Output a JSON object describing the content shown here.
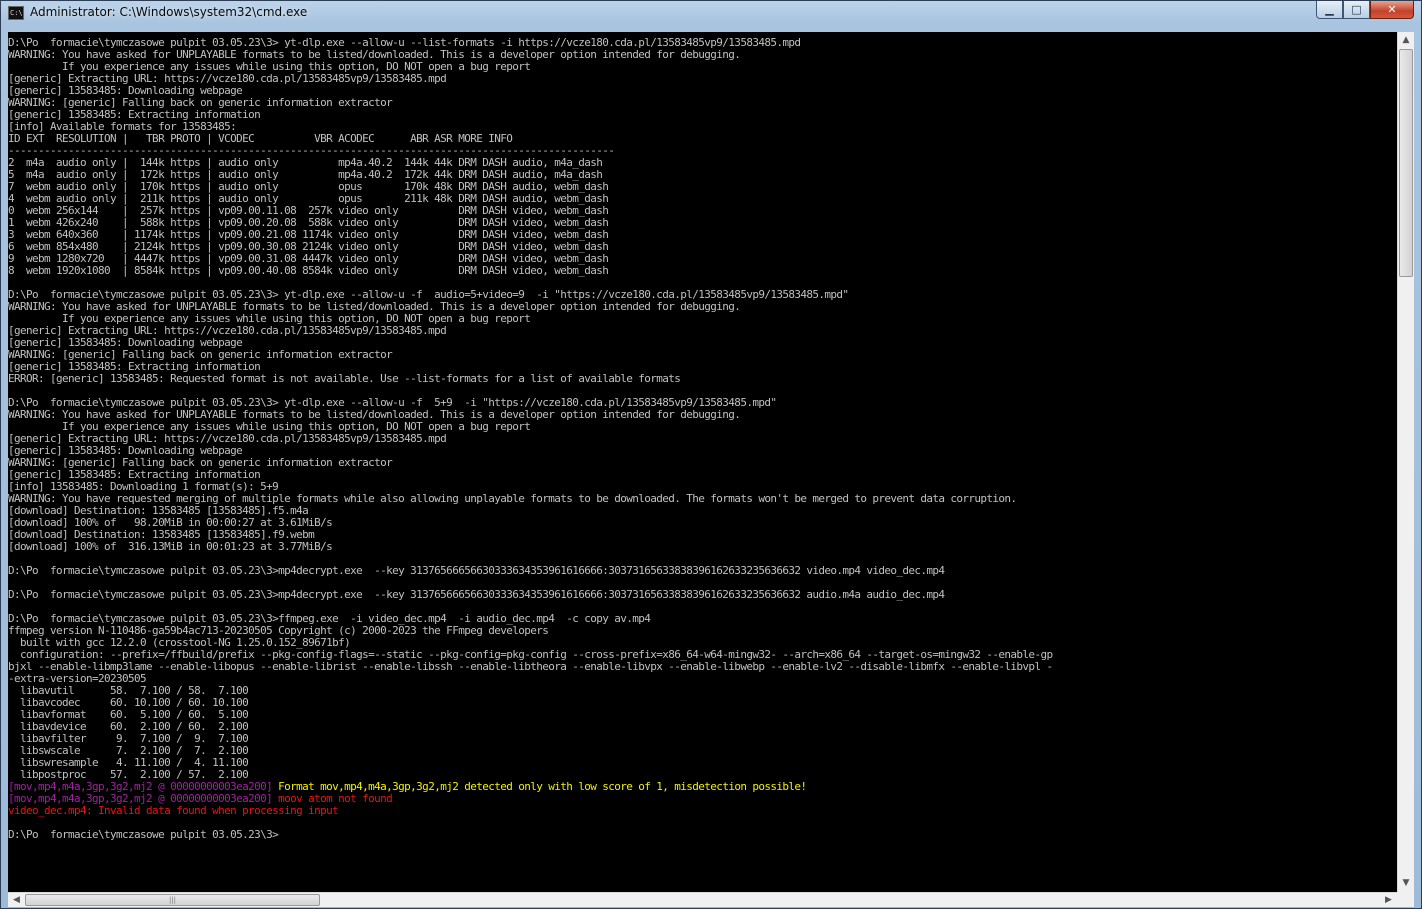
{
  "window": {
    "title": "Administrator: C:\\Windows\\system32\\cmd.exe",
    "icon": "cmd-icon",
    "icon_text": "C:\\",
    "min_glyph": "▁",
    "max_glyph": "□",
    "close_glyph": "✕"
  },
  "console": {
    "colors": {
      "background": "#000000",
      "text": "#c0c0c0",
      "purple": "#a020a0",
      "yellow": "#f0f000",
      "red": "#ee1111"
    },
    "lines": [
      [
        {
          "t": "D:\\Po  formacie\\tymczasowe pulpit 03.05.23\\3> yt-dlp.exe --allow-u --list-formats -i https://vcze180.cda.pl/13583485vp9/13583485.mpd",
          "c": "default"
        }
      ],
      [
        {
          "t": "WARNING: You have asked for UNPLAYABLE formats to be listed/downloaded. This is a developer option intended for debugging.",
          "c": "default"
        }
      ],
      [
        {
          "t": "         If you experience any issues while using this option, DO NOT open a bug report",
          "c": "default"
        }
      ],
      [
        {
          "t": "[generic] Extracting URL: https://vcze180.cda.pl/13583485vp9/13583485.mpd",
          "c": "default"
        }
      ],
      [
        {
          "t": "[generic] 13583485: Downloading webpage",
          "c": "default"
        }
      ],
      [
        {
          "t": "WARNING: [generic] Falling back on generic information extractor",
          "c": "default"
        }
      ],
      [
        {
          "t": "[generic] 13583485: Extracting information",
          "c": "default"
        }
      ],
      [
        {
          "t": "[info] Available formats for 13583485:",
          "c": "default"
        }
      ],
      [
        {
          "t": "ID EXT  RESOLUTION |   TBR PROTO | VCODEC          VBR ACODEC      ABR ASR MORE INFO",
          "c": "default"
        }
      ],
      [
        {
          "t": "-----------------------------------------------------------------------------------------------------",
          "c": "default"
        }
      ],
      [
        {
          "t": "2  m4a  audio only |  144k https | audio only          mp4a.40.2  144k 44k DRM DASH audio, m4a_dash",
          "c": "default"
        }
      ],
      [
        {
          "t": "5  m4a  audio only |  172k https | audio only          mp4a.40.2  172k 44k DRM DASH audio, m4a_dash",
          "c": "default"
        }
      ],
      [
        {
          "t": "7  webm audio only |  170k https | audio only          opus       170k 48k DRM DASH audio, webm_dash",
          "c": "default"
        }
      ],
      [
        {
          "t": "4  webm audio only |  211k https | audio only          opus       211k 48k DRM DASH audio, webm_dash",
          "c": "default"
        }
      ],
      [
        {
          "t": "0  webm 256x144    |  257k https | vp09.00.11.08  257k video only          DRM DASH video, webm_dash",
          "c": "default"
        }
      ],
      [
        {
          "t": "1  webm 426x240    |  588k https | vp09.00.20.08  588k video only          DRM DASH video, webm_dash",
          "c": "default"
        }
      ],
      [
        {
          "t": "3  webm 640x360    | 1174k https | vp09.00.21.08 1174k video only          DRM DASH video, webm_dash",
          "c": "default"
        }
      ],
      [
        {
          "t": "6  webm 854x480    | 2124k https | vp09.00.30.08 2124k video only          DRM DASH video, webm_dash",
          "c": "default"
        }
      ],
      [
        {
          "t": "9  webm 1280x720   | 4447k https | vp09.00.31.08 4447k video only          DRM DASH video, webm_dash",
          "c": "default"
        }
      ],
      [
        {
          "t": "8  webm 1920x1080  | 8584k https | vp09.00.40.08 8584k video only          DRM DASH video, webm_dash",
          "c": "default"
        }
      ],
      [
        {
          "t": "",
          "c": "default"
        }
      ],
      [
        {
          "t": "D:\\Po  formacie\\tymczasowe pulpit 03.05.23\\3> yt-dlp.exe --allow-u -f  audio=5+video=9  -i \"https://vcze180.cda.pl/13583485vp9/13583485.mpd\"",
          "c": "default"
        }
      ],
      [
        {
          "t": "WARNING: You have asked for UNPLAYABLE formats to be listed/downloaded. This is a developer option intended for debugging.",
          "c": "default"
        }
      ],
      [
        {
          "t": "         If you experience any issues while using this option, DO NOT open a bug report",
          "c": "default"
        }
      ],
      [
        {
          "t": "[generic] Extracting URL: https://vcze180.cda.pl/13583485vp9/13583485.mpd",
          "c": "default"
        }
      ],
      [
        {
          "t": "[generic] 13583485: Downloading webpage",
          "c": "default"
        }
      ],
      [
        {
          "t": "WARNING: [generic] Falling back on generic information extractor",
          "c": "default"
        }
      ],
      [
        {
          "t": "[generic] 13583485: Extracting information",
          "c": "default"
        }
      ],
      [
        {
          "t": "ERROR: [generic] 13583485: Requested format is not available. Use --list-formats for a list of available formats",
          "c": "default"
        }
      ],
      [
        {
          "t": "",
          "c": "default"
        }
      ],
      [
        {
          "t": "D:\\Po  formacie\\tymczasowe pulpit 03.05.23\\3> yt-dlp.exe --allow-u -f  5+9  -i \"https://vcze180.cda.pl/13583485vp9/13583485.mpd\"",
          "c": "default"
        }
      ],
      [
        {
          "t": "WARNING: You have asked for UNPLAYABLE formats to be listed/downloaded. This is a developer option intended for debugging.",
          "c": "default"
        }
      ],
      [
        {
          "t": "         If you experience any issues while using this option, DO NOT open a bug report",
          "c": "default"
        }
      ],
      [
        {
          "t": "[generic] Extracting URL: https://vcze180.cda.pl/13583485vp9/13583485.mpd",
          "c": "default"
        }
      ],
      [
        {
          "t": "[generic] 13583485: Downloading webpage",
          "c": "default"
        }
      ],
      [
        {
          "t": "WARNING: [generic] Falling back on generic information extractor",
          "c": "default"
        }
      ],
      [
        {
          "t": "[generic] 13583485: Extracting information",
          "c": "default"
        }
      ],
      [
        {
          "t": "[info] 13583485: Downloading 1 format(s): 5+9",
          "c": "default"
        }
      ],
      [
        {
          "t": "WARNING: You have requested merging of multiple formats while also allowing unplayable formats to be downloaded. The formats won't be merged to prevent data corruption.",
          "c": "default"
        }
      ],
      [
        {
          "t": "[download] Destination: 13583485 [13583485].f5.m4a",
          "c": "default"
        }
      ],
      [
        {
          "t": "[download] 100% of   98.20MiB in 00:00:27 at 3.61MiB/s",
          "c": "default"
        }
      ],
      [
        {
          "t": "[download] Destination: 13583485 [13583485].f9.webm",
          "c": "default"
        }
      ],
      [
        {
          "t": "[download] 100% of  316.13MiB in 00:01:23 at 3.77MiB/s",
          "c": "default"
        }
      ],
      [
        {
          "t": "",
          "c": "default"
        }
      ],
      [
        {
          "t": "D:\\Po  formacie\\tymczasowe pulpit 03.05.23\\3>mp4decrypt.exe  --key 31376566656630333634353961616666:30373165633838396162633235636632 video.mp4 video_dec.mp4",
          "c": "default"
        }
      ],
      [
        {
          "t": "",
          "c": "default"
        }
      ],
      [
        {
          "t": "D:\\Po  formacie\\tymczasowe pulpit 03.05.23\\3>mp4decrypt.exe  --key 31376566656630333634353961616666:30373165633838396162633235636632 audio.m4a audio_dec.mp4",
          "c": "default"
        }
      ],
      [
        {
          "t": "",
          "c": "default"
        }
      ],
      [
        {
          "t": "D:\\Po  formacie\\tymczasowe pulpit 03.05.23\\3>ffmpeg.exe  -i video_dec.mp4  -i audio_dec.mp4  -c copy av.mp4",
          "c": "default"
        }
      ],
      [
        {
          "t": "ffmpeg version N-110486-ga59b4ac713-20230505 Copyright (c) 2000-2023 the FFmpeg developers",
          "c": "default"
        }
      ],
      [
        {
          "t": "  built with gcc 12.2.0 (crosstool-NG 1.25.0.152_89671bf)",
          "c": "default"
        }
      ],
      [
        {
          "t": "  configuration: --prefix=/ffbuild/prefix --pkg-config-flags=--static --pkg-config=pkg-config --cross-prefix=x86_64-w64-mingw32- --arch=x86_64 --target-os=mingw32 --enable-gp",
          "c": "default"
        }
      ],
      [
        {
          "t": "bjxl --enable-libmp3lame --enable-libopus --enable-librist --enable-libssh --enable-libtheora --enable-libvpx --enable-libwebp --enable-lv2 --disable-libmfx --enable-libvpl -",
          "c": "default"
        }
      ],
      [
        {
          "t": "-extra-version=20230505",
          "c": "default"
        }
      ],
      [
        {
          "t": "  libavutil      58.  7.100 / 58.  7.100",
          "c": "default"
        }
      ],
      [
        {
          "t": "  libavcodec     60. 10.100 / 60. 10.100",
          "c": "default"
        }
      ],
      [
        {
          "t": "  libavformat    60.  5.100 / 60.  5.100",
          "c": "default"
        }
      ],
      [
        {
          "t": "  libavdevice    60.  2.100 / 60.  2.100",
          "c": "default"
        }
      ],
      [
        {
          "t": "  libavfilter     9.  7.100 /  9.  7.100",
          "c": "default"
        }
      ],
      [
        {
          "t": "  libswscale      7.  2.100 /  7.  2.100",
          "c": "default"
        }
      ],
      [
        {
          "t": "  libswresample   4. 11.100 /  4. 11.100",
          "c": "default"
        }
      ],
      [
        {
          "t": "  libpostproc    57.  2.100 / 57.  2.100",
          "c": "default"
        }
      ],
      [
        {
          "t": "[mov,mp4,m4a,3gp,3g2,mj2 @ 00000000003ea200] ",
          "c": "purple"
        },
        {
          "t": "Format mov,mp4,m4a,3gp,3g2,mj2 detected only with low score of 1, misdetection possible!",
          "c": "yellow"
        }
      ],
      [
        {
          "t": "[mov,mp4,m4a,3gp,3g2,mj2 @ 00000000003ea200] ",
          "c": "purple"
        },
        {
          "t": "moov atom not found",
          "c": "red"
        }
      ],
      [
        {
          "t": "video_dec.mp4: Invalid data found when processing input",
          "c": "red"
        }
      ],
      [
        {
          "t": "",
          "c": "default"
        }
      ],
      [
        {
          "t": "D:\\Po  formacie\\tymczasowe pulpit 03.05.23\\3>",
          "c": "default"
        }
      ]
    ]
  },
  "scrollbars": {
    "up_glyph": "▲",
    "down_glyph": "▼",
    "left_glyph": "◀",
    "right_glyph": "▶",
    "grip_glyph": "|||"
  }
}
